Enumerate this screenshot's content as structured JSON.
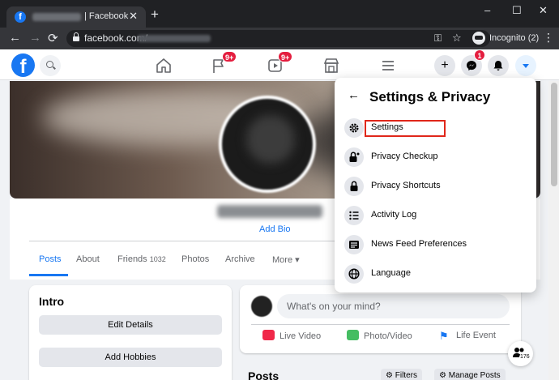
{
  "browser": {
    "tab_title": "| Facebook",
    "tab_close": "✕",
    "new_tab": "+",
    "window_controls": {
      "minimize": "–",
      "maximize": "☐",
      "close": "✕"
    },
    "nav": {
      "back": "←",
      "forward": "→",
      "reload": "⟳"
    },
    "url": "facebook.com/",
    "incognito_label": "Incognito (2)",
    "menu": "⋮",
    "key_icon": "key-icon",
    "star_icon": "star-icon"
  },
  "facebook": {
    "logo": "f",
    "nav_badges": {
      "pages": "9+",
      "watch": "9+",
      "messenger": "1"
    },
    "create_label": "+",
    "profile": {
      "add_bio": "Add Bio",
      "tabs": [
        {
          "label": "Posts"
        },
        {
          "label": "About"
        },
        {
          "label": "Friends",
          "count": "1032"
        },
        {
          "label": "Photos"
        },
        {
          "label": "Archive"
        },
        {
          "label": "More ▾"
        }
      ]
    },
    "intro": {
      "title": "Intro",
      "buttons": [
        "Edit Details",
        "Add Hobbies"
      ]
    },
    "composer": {
      "placeholder": "What's on your mind?",
      "actions": [
        "Live Video",
        "Photo/Video",
        "Life Event"
      ]
    },
    "posts_section": {
      "title": "Posts",
      "filters": "⚙ Filters",
      "manage": "⚙ Manage Posts"
    },
    "chat_count": "176"
  },
  "dropdown": {
    "back_arrow": "←",
    "title": "Settings & Privacy",
    "items": [
      {
        "label": "Settings",
        "icon": "gear-icon"
      },
      {
        "label": "Privacy Checkup",
        "icon": "lock-star-icon"
      },
      {
        "label": "Privacy Shortcuts",
        "icon": "lock-icon"
      },
      {
        "label": "Activity Log",
        "icon": "list-icon"
      },
      {
        "label": "News Feed Preferences",
        "icon": "newsfeed-icon"
      },
      {
        "label": "Language",
        "icon": "globe-icon"
      }
    ]
  },
  "colors": {
    "facebook_blue": "#1877f2",
    "badge_red": "#e41e3f",
    "highlight_red": "#e0271a",
    "chrome_dark": "#202124"
  }
}
